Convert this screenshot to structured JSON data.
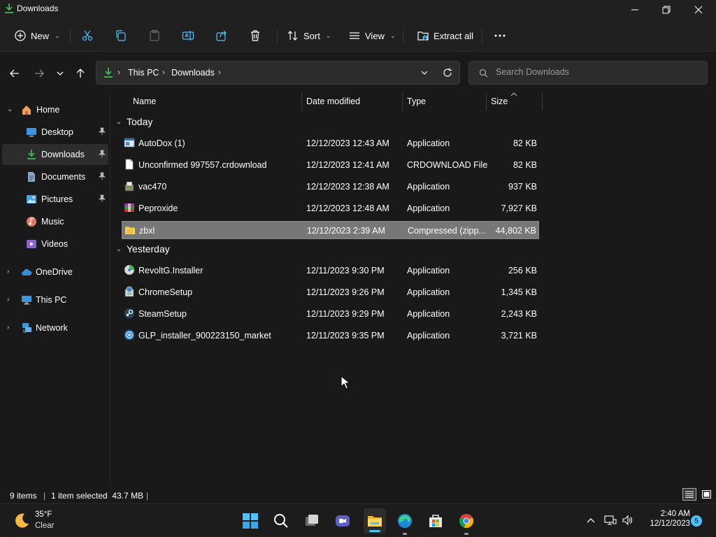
{
  "window": {
    "title": "Downloads"
  },
  "toolbar": {
    "new_label": "New",
    "sort_label": "Sort",
    "view_label": "View",
    "extract_label": "Extract all"
  },
  "address": {
    "crumbs": [
      "This PC",
      "Downloads"
    ],
    "search_placeholder": "Search Downloads"
  },
  "sidebar": {
    "items": [
      {
        "label": "Home",
        "icon": "home-icon"
      },
      {
        "label": "Desktop",
        "icon": "desktop-icon"
      },
      {
        "label": "Downloads",
        "icon": "download-icon"
      },
      {
        "label": "Documents",
        "icon": "documents-icon"
      },
      {
        "label": "Pictures",
        "icon": "pictures-icon"
      },
      {
        "label": "Music",
        "icon": "music-icon"
      },
      {
        "label": "Videos",
        "icon": "videos-icon"
      },
      {
        "label": "OneDrive",
        "icon": "cloud-icon"
      },
      {
        "label": "This PC",
        "icon": "computer-icon"
      },
      {
        "label": "Network",
        "icon": "network-icon"
      }
    ]
  },
  "columns": {
    "name": "Name",
    "date": "Date modified",
    "type": "Type",
    "size": "Size"
  },
  "groups": [
    {
      "label": "Today",
      "files": [
        {
          "name": "AutoDox (1)",
          "date": "12/12/2023 12:43 AM",
          "type": "Application",
          "size": "82 KB",
          "icon": "app-window-icon"
        },
        {
          "name": "Unconfirmed 997557.crdownload",
          "date": "12/12/2023 12:41 AM",
          "type": "CRDOWNLOAD File",
          "size": "82 KB",
          "icon": "blank-file-icon"
        },
        {
          "name": "vac470",
          "date": "12/12/2023 12:38 AM",
          "type": "Application",
          "size": "937 KB",
          "icon": "installer-icon"
        },
        {
          "name": "Peproxide",
          "date": "12/12/2023 12:48 AM",
          "type": "Application",
          "size": "7,927 KB",
          "icon": "archive-app-icon"
        },
        {
          "name": "zbxl",
          "date": "12/12/2023 2:39 AM",
          "type": "Compressed (zipp...",
          "size": "44,802 KB",
          "icon": "zip-folder-icon"
        }
      ]
    },
    {
      "label": "Yesterday",
      "files": [
        {
          "name": "RevoltG.Installer",
          "date": "12/11/2023 9:30 PM",
          "type": "Application",
          "size": "256 KB",
          "icon": "installer-disc-icon"
        },
        {
          "name": "ChromeSetup",
          "date": "12/11/2023 9:26 PM",
          "type": "Application",
          "size": "1,345 KB",
          "icon": "setup-icon"
        },
        {
          "name": "SteamSetup",
          "date": "12/11/2023 9:29 PM",
          "type": "Application",
          "size": "2,243 KB",
          "icon": "steam-icon"
        },
        {
          "name": "GLP_installer_900223150_market",
          "date": "12/11/2023 9:35 PM",
          "type": "Application",
          "size": "3,721 KB",
          "icon": "globe-installer-icon"
        }
      ]
    }
  ],
  "status": {
    "count": "9 items",
    "selection": "1 item selected  43.7 MB"
  },
  "taskbar": {
    "weather_temp": "35°F",
    "weather_desc": "Clear",
    "time": "2:40 AM",
    "date": "12/12/2023",
    "notification_count": "5"
  },
  "colors": {
    "selection": "#777777",
    "accent_blue": "#4cc2ff",
    "download_green": "#3fb950",
    "folder_yellow": "#f0c43f"
  }
}
